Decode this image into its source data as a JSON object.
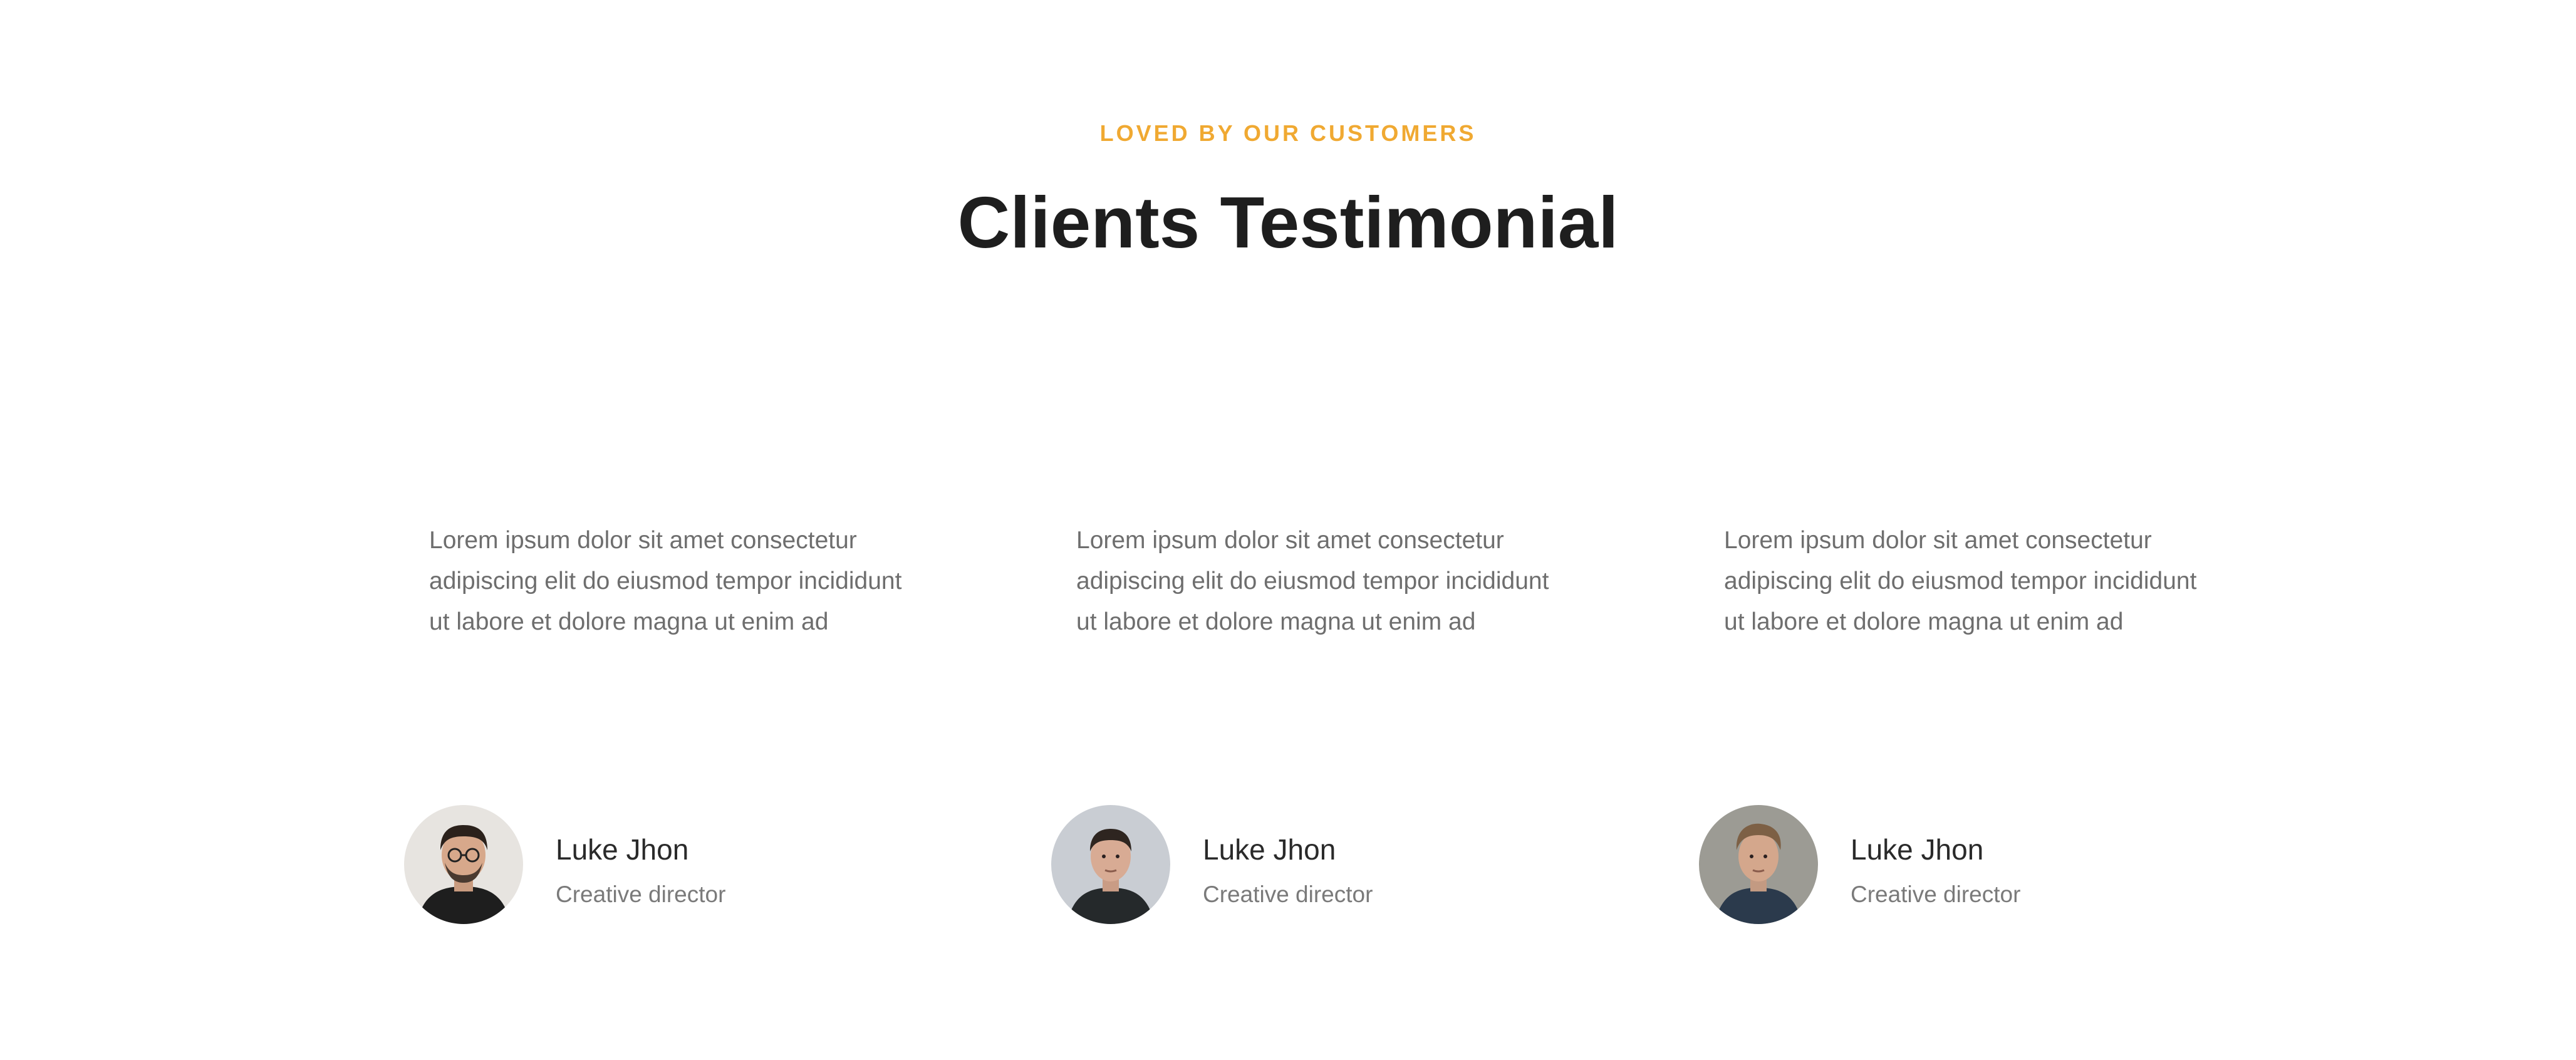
{
  "header": {
    "eyebrow": "LOVED BY OUR CUSTOMERS",
    "title": "Clients Testimonial",
    "accent_color": "#f0a932"
  },
  "testimonials": [
    {
      "quote": "Lorem ipsum dolor sit amet consectetur adipiscing elit do eiusmod tempor incididunt ut labore et dolore magna ut enim ad",
      "name": "Luke Jhon",
      "role": "Creative director",
      "avatar": "person-portrait-glasses"
    },
    {
      "quote": "Lorem ipsum dolor sit amet consectetur adipiscing elit do eiusmod tempor incididunt ut labore et dolore magna ut enim ad",
      "name": "Luke Jhon",
      "role": "Creative director",
      "avatar": "person-portrait"
    },
    {
      "quote": "Lorem ipsum dolor sit amet consectetur adipiscing elit do eiusmod tempor incididunt ut labore et dolore magna ut enim ad",
      "name": "Luke Jhon",
      "role": "Creative director",
      "avatar": "person-portrait"
    }
  ]
}
